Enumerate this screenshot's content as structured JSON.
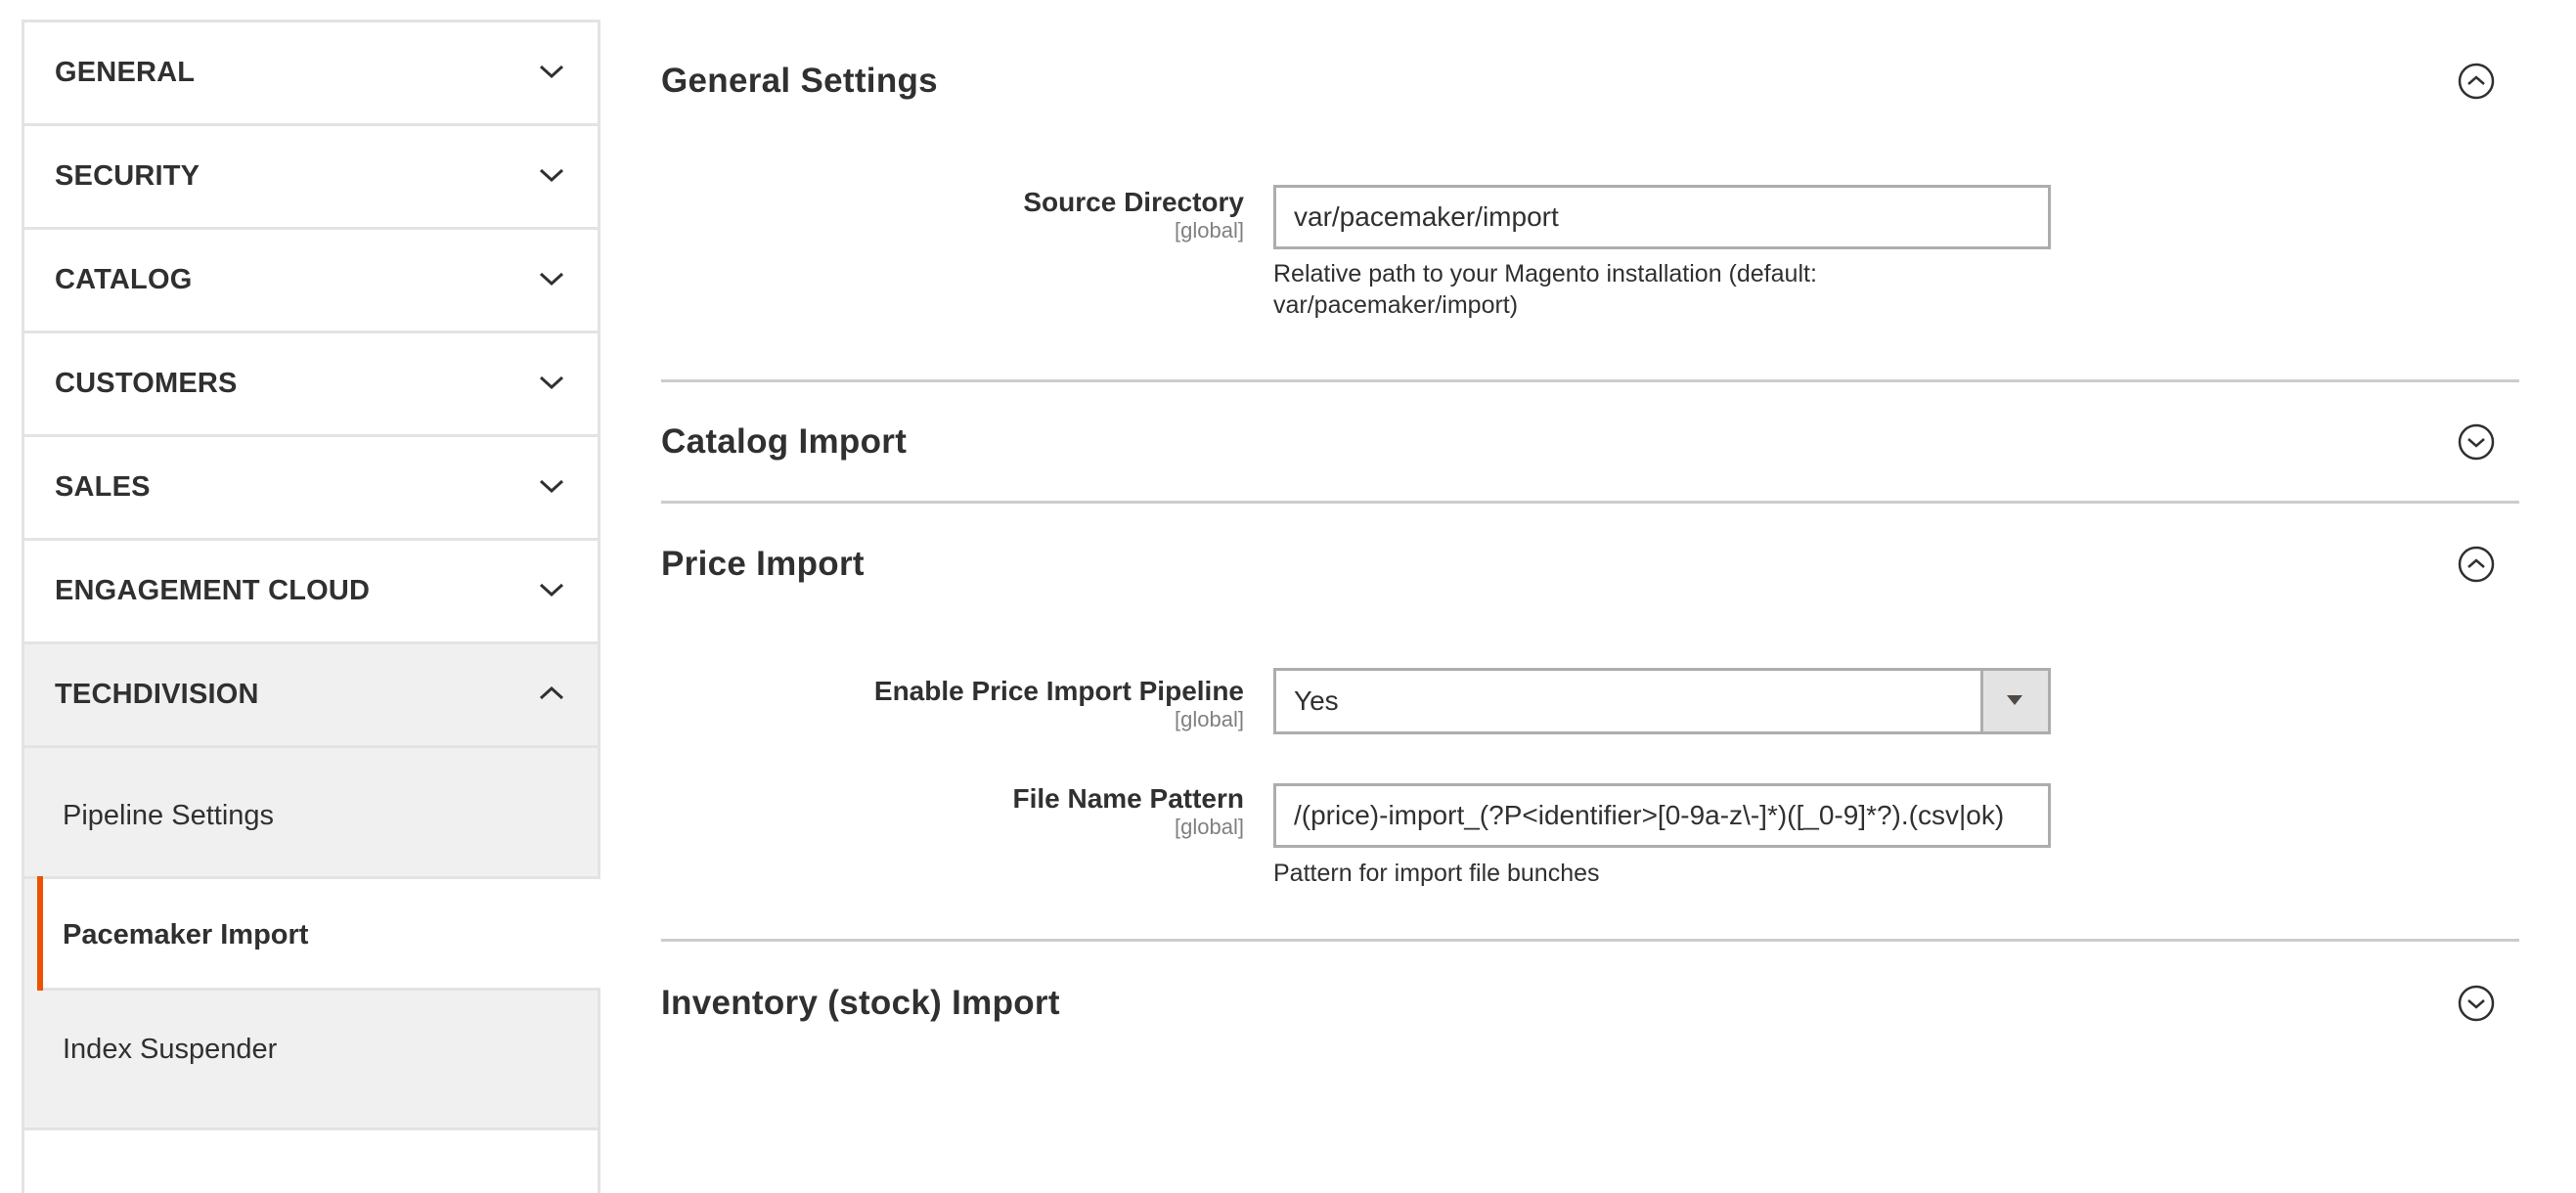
{
  "sidebar": {
    "groups": [
      {
        "label": "GENERAL",
        "expanded": false
      },
      {
        "label": "SECURITY",
        "expanded": false
      },
      {
        "label": "CATALOG",
        "expanded": false
      },
      {
        "label": "CUSTOMERS",
        "expanded": false
      },
      {
        "label": "SALES",
        "expanded": false
      },
      {
        "label": "ENGAGEMENT CLOUD",
        "expanded": false
      },
      {
        "label": "TECHDIVISION",
        "expanded": true
      }
    ],
    "techdivision_items": [
      {
        "label": "Pipeline Settings",
        "active": false
      },
      {
        "label": "Pacemaker Import",
        "active": true
      },
      {
        "label": "Index Suspender",
        "active": false
      }
    ],
    "accent_color": "#eb5202"
  },
  "main": {
    "general_settings": {
      "title": "General Settings",
      "expanded": true,
      "source_directory": {
        "label": "Source Directory",
        "scope": "[global]",
        "value": "var/pacemaker/import",
        "note": "Relative path to your Magento installation (default: var/pacemaker/import)"
      }
    },
    "catalog_import": {
      "title": "Catalog Import",
      "expanded": false
    },
    "price_import": {
      "title": "Price Import",
      "expanded": true,
      "enable_pipeline": {
        "label": "Enable Price Import Pipeline",
        "scope": "[global]",
        "value": "Yes"
      },
      "file_name_pattern": {
        "label": "File Name Pattern",
        "scope": "[global]",
        "value": "/(price)-import_(?P<identifier>[0-9a-z\\-]*)([_0-9]*?).(csv|ok)",
        "note": "Pattern for import file bunches"
      }
    },
    "inventory_import": {
      "title": "Inventory (stock) Import",
      "expanded": false
    }
  }
}
